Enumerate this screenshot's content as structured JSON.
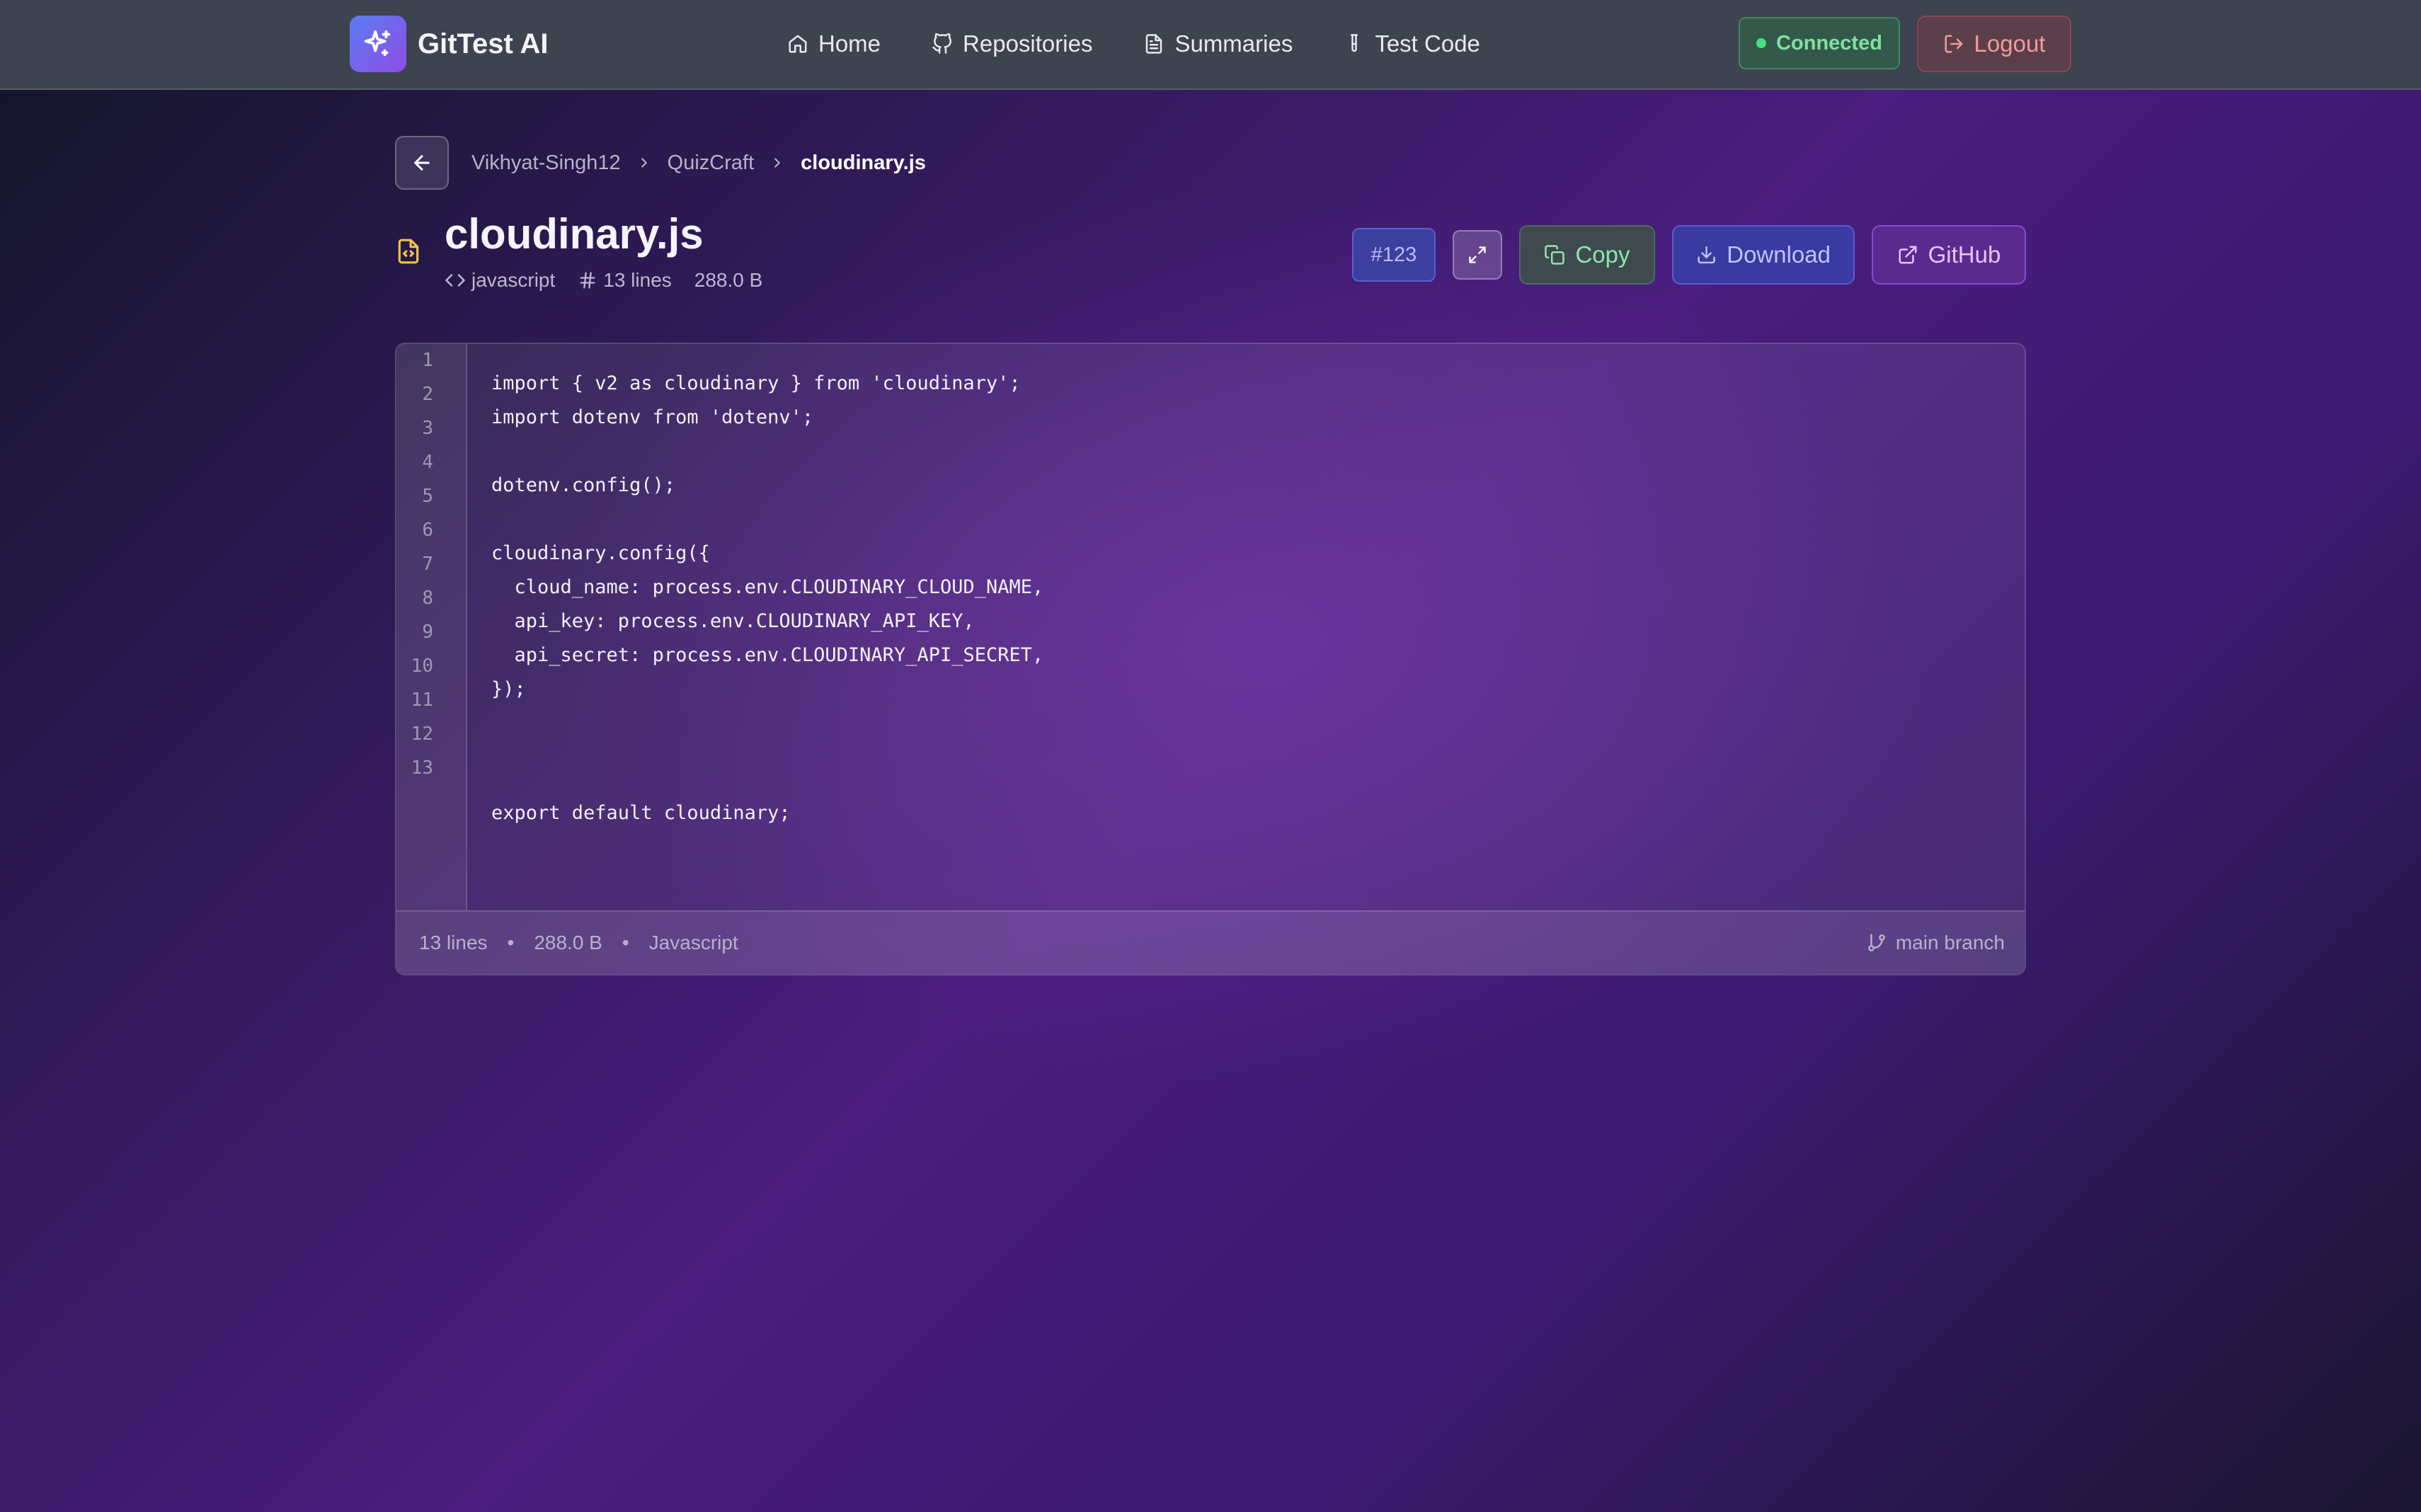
{
  "app": {
    "name": "GitTest AI",
    "logo_icon": "sparkles-icon",
    "accent_gradient": [
      "#5a7cf0",
      "#8e4de8"
    ]
  },
  "nav": {
    "items": [
      {
        "label": "Home",
        "icon": "home-icon"
      },
      {
        "label": "Repositories",
        "icon": "github-icon"
      },
      {
        "label": "Summaries",
        "icon": "document-icon"
      },
      {
        "label": "Test Code",
        "icon": "test-tube-icon"
      }
    ],
    "status": {
      "label": "Connected",
      "color": "#4ade80"
    },
    "logout": {
      "label": "Logout",
      "icon": "logout-icon",
      "color": "#f29b9b"
    }
  },
  "breadcrumb": {
    "items": [
      "Vikhyat-Singh12",
      "QuizCraft",
      "cloudinary.js"
    ]
  },
  "file": {
    "name": "cloudinary.js",
    "icon": "code-file-icon",
    "language": "javascript",
    "lines_label": "13 lines",
    "size": "288.0 B",
    "issue_badge": "#123"
  },
  "actions": {
    "copy": "Copy",
    "download": "Download",
    "github": "GitHub"
  },
  "code": {
    "line_numbers": [
      "1",
      "2",
      "3",
      "4",
      "5",
      "6",
      "7",
      "8",
      "9",
      "10",
      "11",
      "12",
      "13"
    ],
    "lines": [
      "import { v2 as cloudinary } from 'cloudinary';",
      "import dotenv from 'dotenv';",
      "",
      "dotenv.config();",
      "",
      "cloudinary.config({",
      "  cloud_name: process.env.CLOUDINARY_CLOUD_NAME,",
      "  api_key: process.env.CLOUDINARY_API_KEY,",
      "  api_secret: process.env.CLOUDINARY_API_SECRET,",
      "});",
      "",
      "",
      "export default cloudinary;"
    ]
  },
  "footer": {
    "lines": "13 lines",
    "size": "288.0 B",
    "language": "Javascript",
    "branch": "main branch"
  }
}
